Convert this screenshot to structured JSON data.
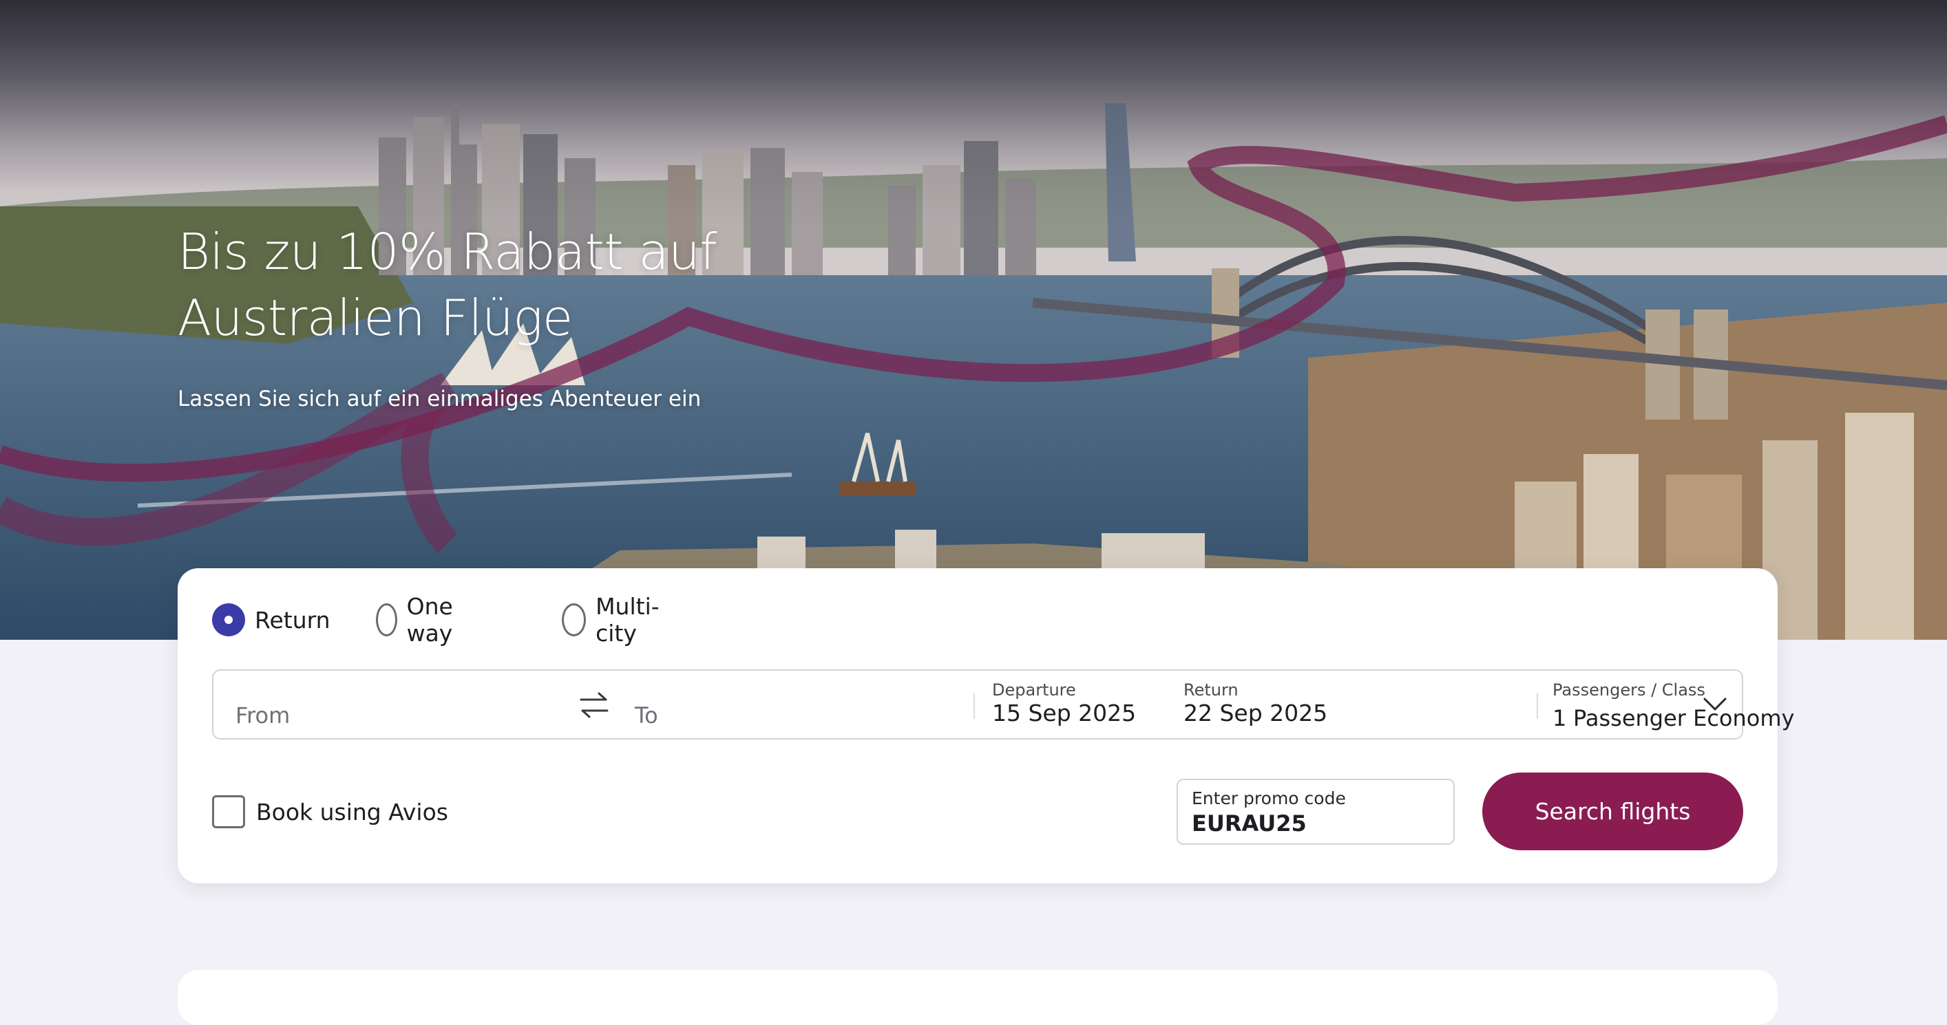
{
  "hero": {
    "title_line1": "Bis zu 10% Rabatt auf",
    "title_line2": "Australien Flüge",
    "subtitle": "Lassen Sie sich auf ein einmaliges Abenteuer ein"
  },
  "trip_type": {
    "options": [
      {
        "label": "Return",
        "selected": true
      },
      {
        "label": "One way",
        "selected": false
      },
      {
        "label": "Multi-city",
        "selected": false
      }
    ]
  },
  "search": {
    "from_placeholder": "From",
    "to_placeholder": "To",
    "departure_label": "Departure",
    "departure_value": "15 Sep 2025",
    "return_label": "Return",
    "return_value": "22 Sep 2025",
    "pax_label": "Passengers / Class",
    "pax_count": "1",
    "pax_value": "Passenger Economy"
  },
  "options": {
    "avios_label": "Book using Avios",
    "avios_checked": false
  },
  "promo": {
    "label": "Enter promo code",
    "value": "EURAU25"
  },
  "actions": {
    "search_label": "Search flights"
  },
  "colors": {
    "brand": "#8a1c52",
    "radio_selected": "#3b3ba8",
    "page_background": "#f1f1f7"
  },
  "icons": [
    "swap-icon",
    "chevron-down-icon",
    "radio-selected-icon"
  ]
}
